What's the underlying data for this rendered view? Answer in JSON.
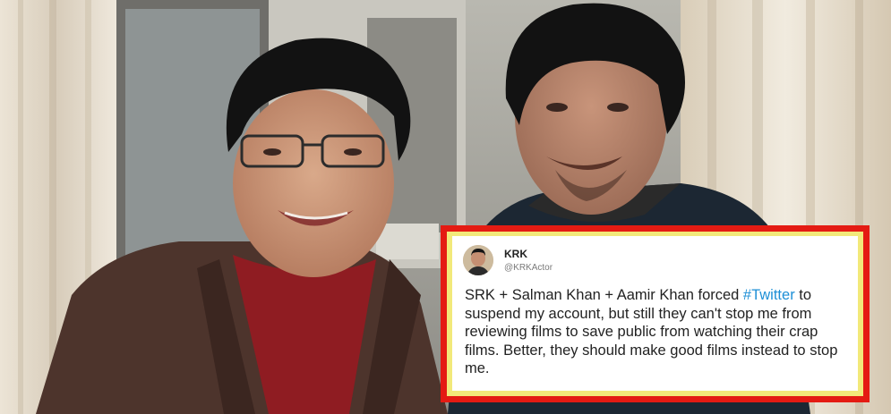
{
  "tweet": {
    "name": "KRK",
    "handle": "@KRKActor",
    "text_before": "SRK + Salman Khan + Aamir Khan forced ",
    "hashtag": "#Twitter",
    "text_after": " to suspend my account, but still they can't stop me from reviewing films to save public from watching their crap films. Better, they should make good films instead to stop me."
  },
  "colors": {
    "frame_border": "#e41b13",
    "frame_fill": "#f2e97a",
    "hashtag": "#1d8fd6"
  }
}
